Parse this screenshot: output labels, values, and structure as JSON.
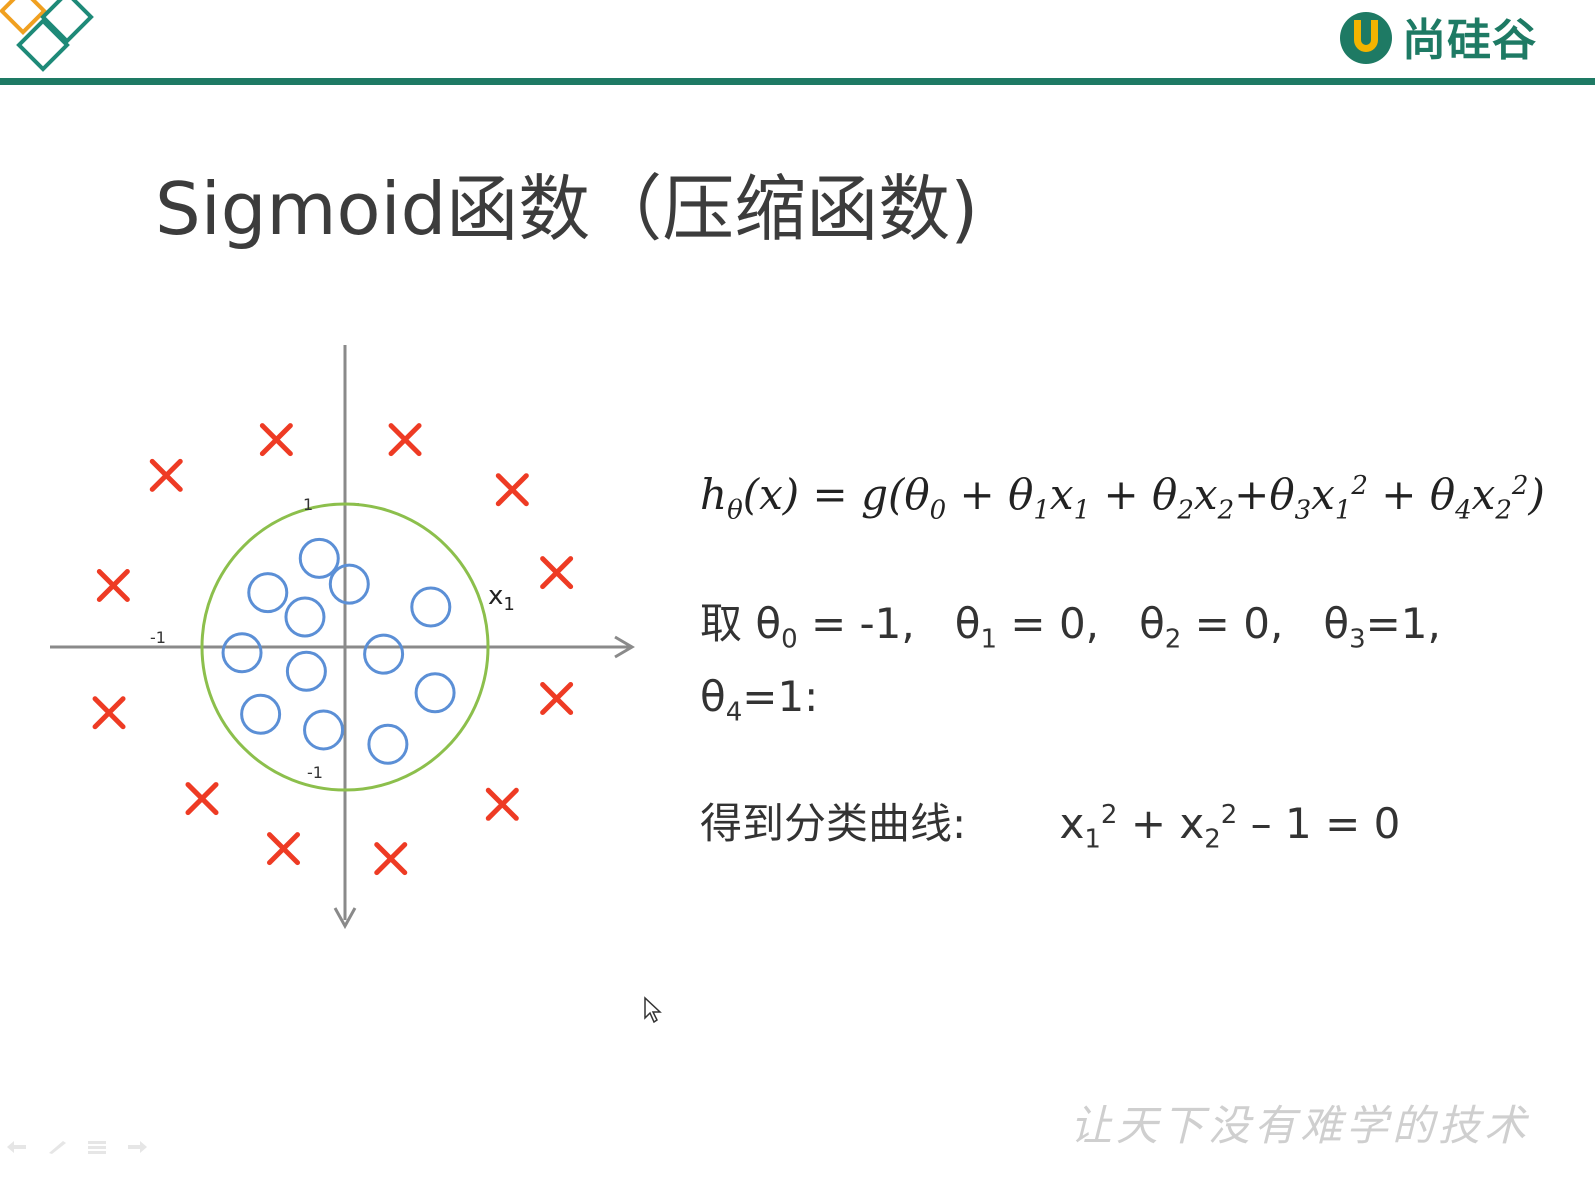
{
  "slide": {
    "title": "Sigmoid函数（压缩函数)"
  },
  "brand": {
    "name": "尚硅谷",
    "color": "#1e7a64"
  },
  "formula": {
    "lhs": "h",
    "lhs_sub": "θ",
    "lhs_arg": "(x) = g(θ",
    "t0": "0",
    "p1": " + θ",
    "t1": "1",
    "x1a": "x",
    "x1a_sub": "1",
    "p2": " + θ",
    "t2": "2",
    "x2a": "x",
    "x2a_sub": "2",
    "p3": "+θ",
    "t3": "3",
    "x1b": "x",
    "x1b_sub": "1",
    "x1b_sup": "2",
    "p4": " + θ",
    "t4": "4",
    "x2b": "x",
    "x2b_sub": "2",
    "x2b_sup": "2",
    "end": ")"
  },
  "params": {
    "prefix": "取 θ",
    "t0_sub": "0",
    "t0_val": " = -1,",
    "t1_sym": "θ",
    "t1_sub": "1",
    "t1_val": " = 0,",
    "t2_sym": "θ",
    "t2_sub": "2",
    "t2_val": " = 0,",
    "t3_sym": "θ",
    "t3_sub": "3",
    "t3_val": "=1,",
    "t4_sym": "θ",
    "t4_sub": "4",
    "t4_val": "=1:"
  },
  "curve": {
    "label": "得到分类曲线:",
    "x1": "x",
    "x1_sub": "1",
    "x1_sup": "2",
    "plus": " + x",
    "x2_sub": "2",
    "x2_sup": "2",
    "rest": " – 1 = 0"
  },
  "watermark": "让天下没有难学的技术",
  "chart_data": {
    "type": "scatter",
    "title": "",
    "xlabel": "x1",
    "ylabel": "",
    "xlim": [
      -2.2,
      2.2
    ],
    "ylim": [
      -2.0,
      1.4
    ],
    "ticks": {
      "x_neg": "-1",
      "y_pos": "1",
      "y_neg": "-1"
    },
    "decision_boundary": {
      "shape": "circle",
      "center": [
        0,
        0
      ],
      "radius": 1,
      "color": "#8cbf4c"
    },
    "series": [
      {
        "marker": "x",
        "color": "#ee3b24",
        "points": [
          [
            -0.48,
            1.45
          ],
          [
            0.42,
            1.45
          ],
          [
            -1.25,
            1.2
          ],
          [
            1.17,
            1.1
          ],
          [
            1.48,
            0.52
          ],
          [
            -1.62,
            0.43
          ],
          [
            -1.65,
            -0.46
          ],
          [
            1.48,
            -0.36
          ],
          [
            -1.0,
            -1.06
          ],
          [
            1.1,
            -1.1
          ],
          [
            -0.43,
            -1.41
          ],
          [
            0.32,
            -1.48
          ]
        ]
      },
      {
        "marker": "o",
        "color": "#5b8fd6",
        "points": [
          [
            -0.18,
            0.62
          ],
          [
            0.03,
            0.44
          ],
          [
            -0.54,
            0.38
          ],
          [
            -0.28,
            0.21
          ],
          [
            0.6,
            0.28
          ],
          [
            -0.72,
            -0.04
          ],
          [
            0.27,
            -0.05
          ],
          [
            -0.27,
            -0.17
          ],
          [
            0.63,
            -0.32
          ],
          [
            -0.59,
            -0.47
          ],
          [
            -0.15,
            -0.58
          ],
          [
            0.3,
            -0.68
          ]
        ]
      }
    ]
  }
}
